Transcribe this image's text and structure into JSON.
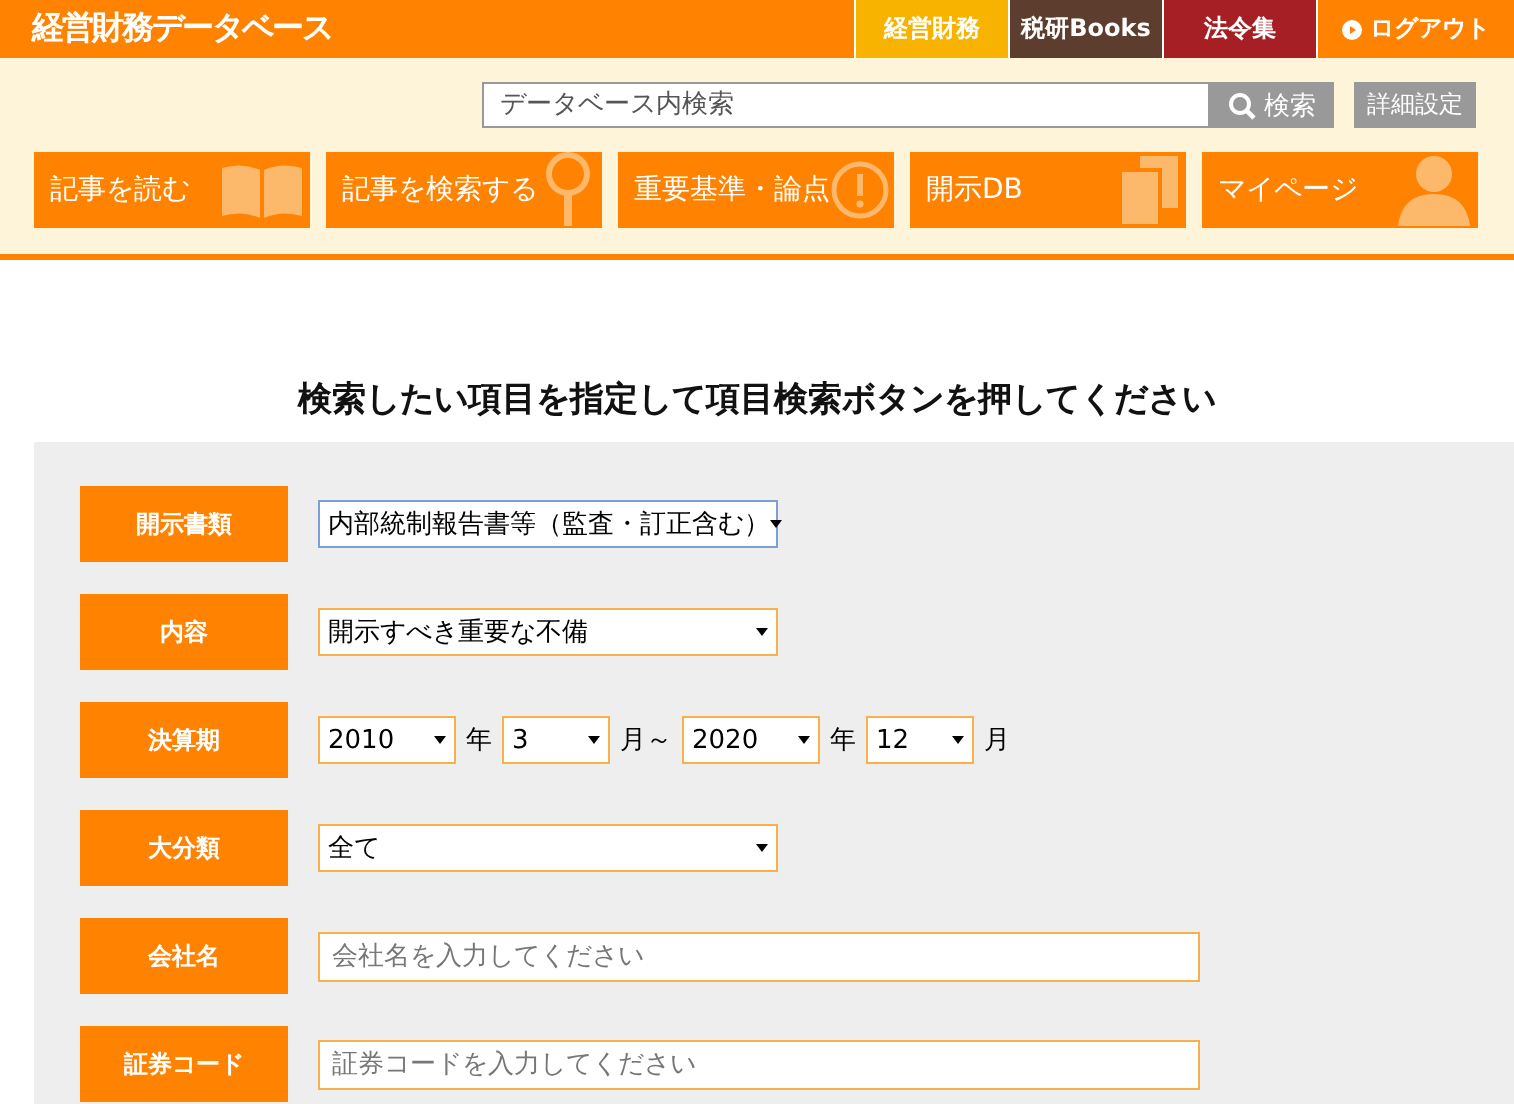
{
  "header": {
    "logo": "経営財務データベース",
    "links": [
      {
        "label": "経営財務",
        "color": "#f7b300",
        "kind": "tab"
      },
      {
        "label": "税研Books",
        "color": "#5c3d2e",
        "kind": "tab"
      },
      {
        "label": "法令集",
        "color": "#a51f24",
        "kind": "tab"
      },
      {
        "label": "ログアウト",
        "color": "#ff8200",
        "kind": "logout"
      }
    ]
  },
  "search": {
    "placeholder": "データベース内検索",
    "button": "検索",
    "advanced": "詳細設定"
  },
  "nav": [
    {
      "label": "記事を読む",
      "kind": "book"
    },
    {
      "label": "記事を検索する",
      "kind": "search"
    },
    {
      "label": "重要基準・論点",
      "kind": "alert"
    },
    {
      "label": "開示DB",
      "kind": "docs"
    },
    {
      "label": "マイページ",
      "kind": "person"
    }
  ],
  "heading": "検索したい項目を指定して項目検索ボタンを押してください",
  "form": [
    {
      "label": "開示書類",
      "kind": "select",
      "value": "内部統制報告書等（監査・訂正含む）",
      "focused": true
    },
    {
      "label": "内容",
      "kind": "select",
      "value": "開示すべき重要な不備",
      "focused": false
    },
    {
      "label": "決算期",
      "kind": "period",
      "parts": [
        {
          "value": "2010",
          "unit": "年"
        },
        {
          "value": "3",
          "unit": "月～"
        },
        {
          "value": "2020",
          "unit": "年"
        },
        {
          "value": "12",
          "unit": "月"
        }
      ]
    },
    {
      "label": "大分類",
      "kind": "select",
      "value": "全て",
      "focused": false
    },
    {
      "label": "会社名",
      "kind": "text",
      "placeholder": "会社名を入力してください"
    },
    {
      "label": "証券コード",
      "kind": "text",
      "placeholder": "証券コードを入力してください"
    }
  ]
}
